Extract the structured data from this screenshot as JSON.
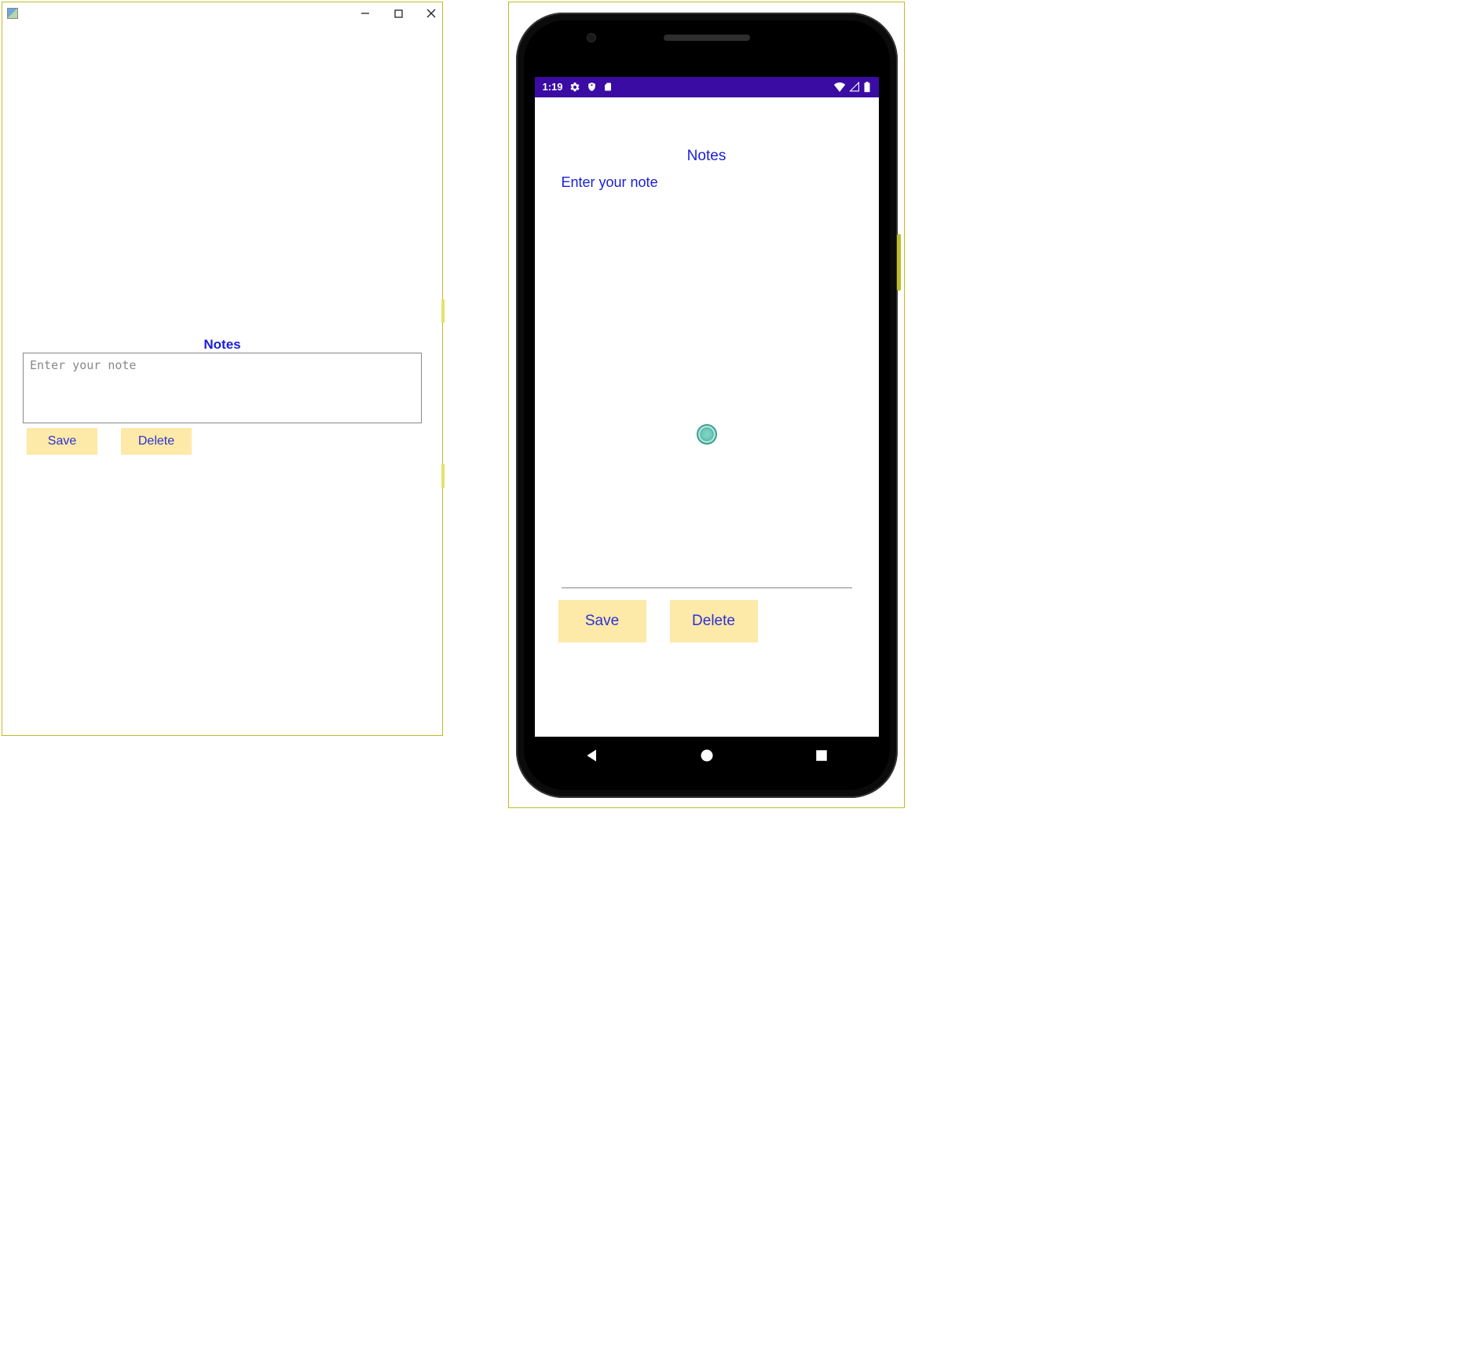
{
  "desktop": {
    "title": "Notes",
    "note_placeholder": "Enter your note",
    "note_value": "",
    "save_label": "Save",
    "delete_label": "Delete"
  },
  "phone": {
    "status_time": "1:19",
    "title": "Notes",
    "hint": "Enter your note",
    "save_label": "Save",
    "delete_label": "Delete"
  }
}
